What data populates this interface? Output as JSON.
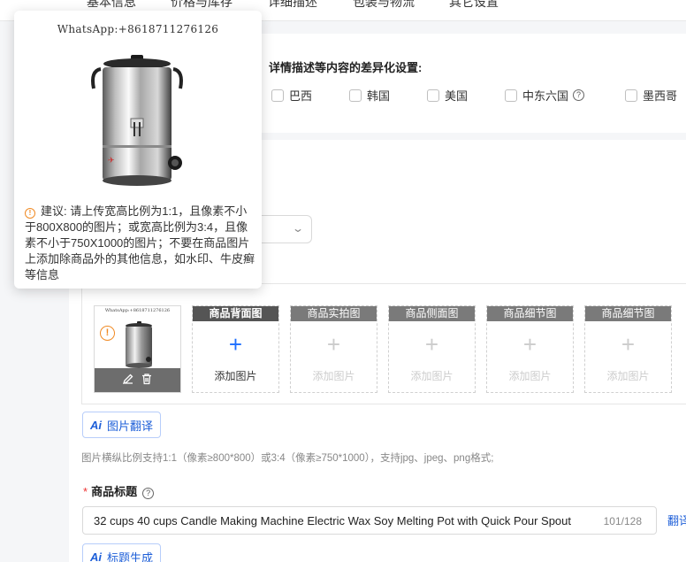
{
  "tabs": [
    "基本信息",
    "价格与库存",
    "详细描述",
    "包装与物流",
    "其它设置"
  ],
  "diff_title": "详情描述等内容的差异化设置:",
  "countries": [
    "巴西",
    "韩国",
    "美国",
    "中东六国",
    "墨西哥"
  ],
  "popover": {
    "watermark": "WhatsApp:+8618711276126",
    "tip": "建议: 请上传宽高比例为1:1，且像素不小于800X800的图片；或宽高比例为3:4，且像素不小于750X1000的图片；不要在商品图片上添加除商品外的其他信息，如水印、牛皮癣等信息"
  },
  "thumbnail": {
    "watermark": "WhatsApp:+8618711276126"
  },
  "image_slots": [
    {
      "title": "商品背面图",
      "label": "添加图片",
      "active": true
    },
    {
      "title": "商品实拍图",
      "label": "添加图片",
      "active": false
    },
    {
      "title": "商品侧面图",
      "label": "添加图片",
      "active": false
    },
    {
      "title": "商品细节图",
      "label": "添加图片",
      "active": false
    },
    {
      "title": "商品细节图",
      "label": "添加图片",
      "active": false
    }
  ],
  "image_translate_btn": "图片翻译",
  "image_hint": "图片横纵比例支持1:1（像素≥800*800）或3:4（像素≥750*1000），支持jpg、jpeg、png格式;",
  "product_title": {
    "label": "商品标题",
    "value": "32 cups 40 cups Candle Making Machine Electric Wax Soy Melting Pot with Quick Pour Spout",
    "count": "101/128",
    "translate_link": "翻译"
  },
  "title_generate_btn": "标题生成",
  "ai_prefix": "Ai",
  "colors": {
    "accent": "#1e5fd8",
    "warning": "#f08a24",
    "required": "#ee3333"
  }
}
